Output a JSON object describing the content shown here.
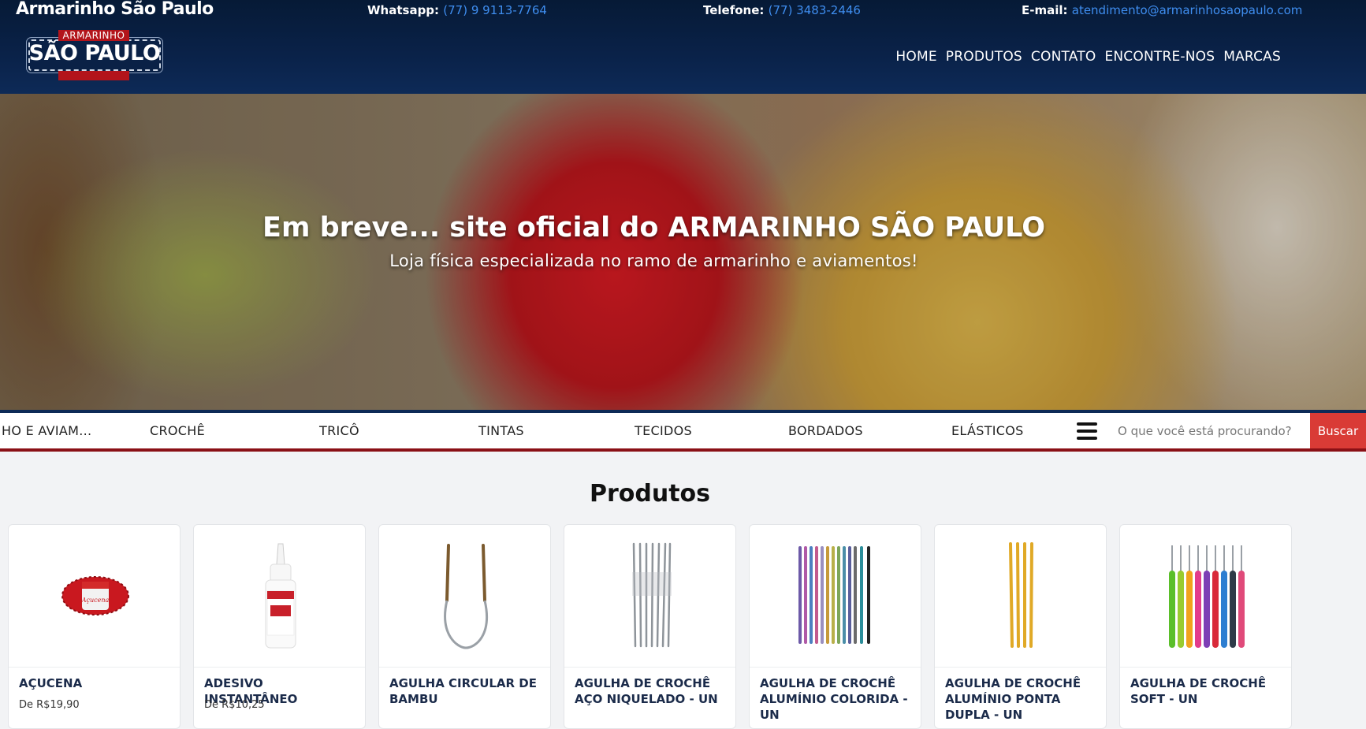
{
  "header": {
    "brand_title": "Armarinho São Paulo",
    "whatsapp_label": "Whatsapp:",
    "whatsapp_value": "(77) 9 9113-7764",
    "phone_label": "Telefone:",
    "phone_value": "(77) 3483-2446",
    "email_label": "E-mail:",
    "email_value": "atendimento@armarinhosaopaulo.com",
    "logo_top": "ARMARINHO",
    "logo_name": "SÃO PAULO",
    "nav": [
      "HOME",
      "PRODUTOS",
      "CONTATO",
      "ENCONTRE-NOS",
      "MARCAS"
    ]
  },
  "hero": {
    "title": "Em breve... site oficial do ARMARINHO SÃO PAULO",
    "subtitle": "Loja física especializada no ramo de armarinho e aviamentos!"
  },
  "categories": [
    "HO E AVIAM...",
    "CROCHÊ",
    "TRICÔ",
    "TINTAS",
    "TECIDOS",
    "BORDADOS",
    "ELÁSTICOS"
  ],
  "search": {
    "placeholder": "O que você está procurando?",
    "button": "Buscar"
  },
  "products": {
    "title": "Produtos",
    "items": [
      {
        "name": "AÇUCENA",
        "price": "De R$19,90",
        "icon": "yarn-skein-icon"
      },
      {
        "name": "ADESIVO INSTANTÂNEO",
        "price": "De R$10,25",
        "icon": "glue-bottle-icon"
      },
      {
        "name": "AGULHA CIRCULAR DE BAMBU",
        "price": "",
        "icon": "circular-needle-icon"
      },
      {
        "name": "AGULHA DE CROCHÊ AÇO NIQUELADO - UN",
        "price": "",
        "icon": "steel-hooks-icon"
      },
      {
        "name": "AGULHA DE CROCHÊ ALUMÍNIO COLORIDA - UN",
        "price": "",
        "icon": "colored-hooks-icon"
      },
      {
        "name": "AGULHA DE CROCHÊ ALUMÍNIO PONTA DUPLA - UN",
        "price": "",
        "icon": "double-hooks-icon"
      },
      {
        "name": "AGULHA DE CROCHÊ SOFT - UN",
        "price": "",
        "icon": "soft-hooks-icon"
      }
    ]
  },
  "colors": {
    "header_bg": "#0a2249",
    "link_blue": "#3f8ef0",
    "search_button": "#d93b36",
    "accent_red": "#8a1016"
  }
}
